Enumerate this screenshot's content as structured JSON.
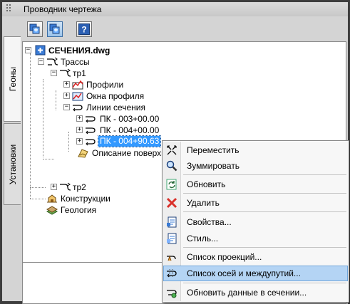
{
  "window": {
    "title": "Проводник чертежа"
  },
  "side_tabs": {
    "geons": "Геоны",
    "settings": "Установки"
  },
  "toolbar": {
    "buttons": [
      {
        "icon": "drawing-items-icon"
      },
      {
        "icon": "drawing-items-active-icon"
      },
      {
        "icon": "help-icon"
      }
    ]
  },
  "tree": {
    "root": "СЕЧЕНИЯ.dwg",
    "alignments": "Трассы",
    "tr1": "тр1",
    "profiles": "Профили",
    "profile_windows": "Окна профиля",
    "section_lines": "Линии сечения",
    "pk1": "ПК - 003+00.00",
    "pk2": "ПК - 004+00.00",
    "pk3": "ПК - 004+90.63",
    "surface_desc": "Описание поверхно",
    "tr2": "тр2",
    "structures": "Конструкции",
    "geology": "Геология"
  },
  "context_menu": {
    "items": [
      {
        "label": "Переместить",
        "icon": "move-icon"
      },
      {
        "label": "Зуммировать",
        "icon": "zoom-icon"
      },
      {
        "label": "Обновить",
        "icon": "refresh-icon"
      },
      {
        "label": "Удалить",
        "icon": "delete-icon"
      },
      {
        "label": "Свойства...",
        "icon": "properties-icon"
      },
      {
        "label": "Стиль...",
        "icon": "style-icon"
      },
      {
        "label": "Список проекций...",
        "icon": "projections-list-icon"
      },
      {
        "label": "Список осей и междупутий...",
        "icon": "axes-list-icon"
      },
      {
        "label": "Обновить данные в сечении...",
        "icon": "update-section-icon"
      }
    ],
    "highlighted": "Список осей и междупутий..."
  },
  "colors": {
    "selection": "#3399ff",
    "menu_highlight": "#b4d4f4",
    "chrome": "#d4d4d4"
  }
}
